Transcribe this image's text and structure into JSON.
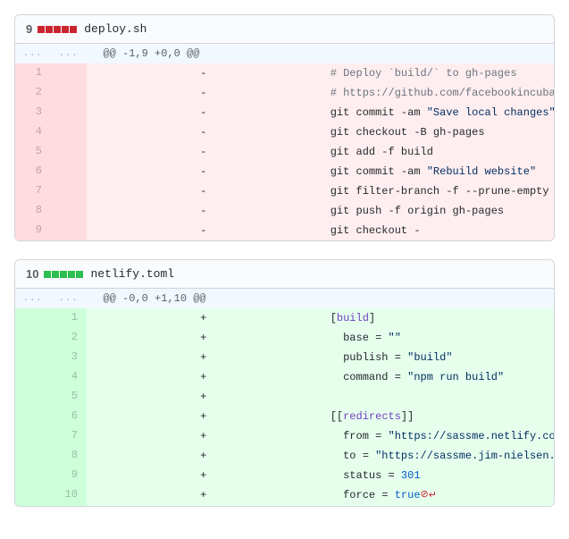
{
  "files": [
    {
      "count": "9",
      "squares": [
        "del",
        "del",
        "del",
        "del",
        "del"
      ],
      "filename": "deploy.sh",
      "hunk": "@@ -1,9 +0,0 @@",
      "lines": [
        {
          "type": "del",
          "old": "1",
          "new": "",
          "marker": "-",
          "tokens": [
            {
              "t": "comment",
              "v": " # Deploy `build/` to gh-pages"
            }
          ]
        },
        {
          "type": "del",
          "old": "2",
          "new": "",
          "marker": "-",
          "tokens": [
            {
              "t": "comment",
              "v": " # https://github.com/facebookincubator/create-react-app/blob/master/t"
            }
          ]
        },
        {
          "type": "del",
          "old": "3",
          "new": "",
          "marker": "-",
          "tokens": [
            {
              "t": "plain",
              "v": " git commit -am "
            },
            {
              "t": "str",
              "v": "\"Save local changes\""
            }
          ]
        },
        {
          "type": "del",
          "old": "4",
          "new": "",
          "marker": "-",
          "tokens": [
            {
              "t": "plain",
              "v": " git checkout -B gh-pages"
            }
          ]
        },
        {
          "type": "del",
          "old": "5",
          "new": "",
          "marker": "-",
          "tokens": [
            {
              "t": "plain",
              "v": " git add -f build"
            }
          ]
        },
        {
          "type": "del",
          "old": "6",
          "new": "",
          "marker": "-",
          "tokens": [
            {
              "t": "plain",
              "v": " git commit -am "
            },
            {
              "t": "str",
              "v": "\"Rebuild website\""
            }
          ]
        },
        {
          "type": "del",
          "old": "7",
          "new": "",
          "marker": "-",
          "tokens": [
            {
              "t": "plain",
              "v": " git filter-branch -f --prune-empty --subdirectory-filter build"
            }
          ]
        },
        {
          "type": "del",
          "old": "8",
          "new": "",
          "marker": "-",
          "tokens": [
            {
              "t": "plain",
              "v": " git push -f origin gh-pages"
            }
          ]
        },
        {
          "type": "del",
          "old": "9",
          "new": "",
          "marker": "-",
          "tokens": [
            {
              "t": "plain",
              "v": " git checkout -"
            }
          ]
        }
      ]
    },
    {
      "count": "10",
      "squares": [
        "add",
        "add",
        "add",
        "add",
        "add"
      ],
      "filename": "netlify.toml",
      "hunk": "@@ -0,0 +1,10 @@",
      "lines": [
        {
          "type": "add",
          "old": "",
          "new": "1",
          "marker": "+",
          "tokens": [
            {
              "t": "plain",
              "v": " ["
            },
            {
              "t": "ent",
              "v": "build"
            },
            {
              "t": "plain",
              "v": "]"
            }
          ]
        },
        {
          "type": "add",
          "old": "",
          "new": "2",
          "marker": "+",
          "tokens": [
            {
              "t": "plain",
              "v": "   base = "
            },
            {
              "t": "str",
              "v": "\"\""
            }
          ]
        },
        {
          "type": "add",
          "old": "",
          "new": "3",
          "marker": "+",
          "tokens": [
            {
              "t": "plain",
              "v": "   publish = "
            },
            {
              "t": "str",
              "v": "\"build\""
            }
          ]
        },
        {
          "type": "add",
          "old": "",
          "new": "4",
          "marker": "+",
          "tokens": [
            {
              "t": "plain",
              "v": "   command = "
            },
            {
              "t": "str",
              "v": "\"npm run build\""
            }
          ]
        },
        {
          "type": "add",
          "old": "",
          "new": "5",
          "marker": "+",
          "tokens": [
            {
              "t": "plain",
              "v": " "
            }
          ]
        },
        {
          "type": "add",
          "old": "",
          "new": "6",
          "marker": "+",
          "tokens": [
            {
              "t": "plain",
              "v": " [["
            },
            {
              "t": "ent",
              "v": "redirects"
            },
            {
              "t": "plain",
              "v": "]]"
            }
          ]
        },
        {
          "type": "add",
          "old": "",
          "new": "7",
          "marker": "+",
          "tokens": [
            {
              "t": "plain",
              "v": "   from = "
            },
            {
              "t": "str",
              "v": "\"https://sassme.netlify.com/*\""
            }
          ]
        },
        {
          "type": "add",
          "old": "",
          "new": "8",
          "marker": "+",
          "tokens": [
            {
              "t": "plain",
              "v": "   to = "
            },
            {
              "t": "str",
              "v": "\"https://sassme.jim-nielsen.com/:splat\""
            }
          ]
        },
        {
          "type": "add",
          "old": "",
          "new": "9",
          "marker": "+",
          "tokens": [
            {
              "t": "plain",
              "v": "   status = "
            },
            {
              "t": "num",
              "v": "301"
            }
          ]
        },
        {
          "type": "add",
          "old": "",
          "new": "10",
          "marker": "+",
          "tokens": [
            {
              "t": "plain",
              "v": "   force = "
            },
            {
              "t": "bool",
              "v": "true"
            }
          ],
          "eof": true
        }
      ]
    }
  ],
  "labels": {
    "ellipsis": "...",
    "no_newline_title": "No newline at end of file"
  },
  "chart_data": null
}
